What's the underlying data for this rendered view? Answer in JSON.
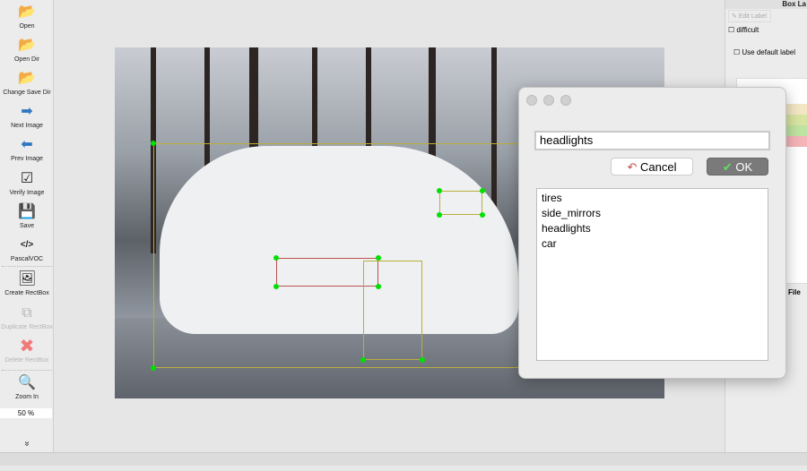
{
  "toolbar": {
    "items": [
      {
        "label": "Open",
        "icon": "folder-icon"
      },
      {
        "label": "Open Dir",
        "icon": "folder-icon"
      },
      {
        "label": "Change Save Dir",
        "icon": "folder-icon"
      },
      {
        "label": "Next Image",
        "icon": "arrow-right-icon"
      },
      {
        "label": "Prev Image",
        "icon": "arrow-left-icon"
      },
      {
        "label": "Verify Image",
        "icon": "checkbox-icon"
      },
      {
        "label": "Save",
        "icon": "floppy-icon"
      },
      {
        "label": "PascalVOC",
        "icon": "code-icon"
      },
      {
        "label": "Create RectBox",
        "icon": "rectbox-icon"
      },
      {
        "label": "Duplicate RectBox",
        "icon": "duplicate-icon"
      },
      {
        "label": "Delete RectBox",
        "icon": "delete-x-icon"
      },
      {
        "label": "Zoom In",
        "icon": "zoom-in-icon"
      }
    ],
    "zoom": "50 %",
    "more": "»"
  },
  "dock": {
    "title": "Box La",
    "edit_label": "Edit Label",
    "difficult": "difficult",
    "use_default_label": "Use default label",
    "file_tab": "File",
    "label_colors": [
      "#f2e6c4",
      "#d8e4a0",
      "#bfe3a0",
      "#f4b4b8"
    ]
  },
  "dialog": {
    "input_value": "headlights",
    "cancel": "Cancel",
    "ok": "OK",
    "labels": [
      "tires",
      "side_mirrors",
      "headlights",
      "car"
    ]
  }
}
